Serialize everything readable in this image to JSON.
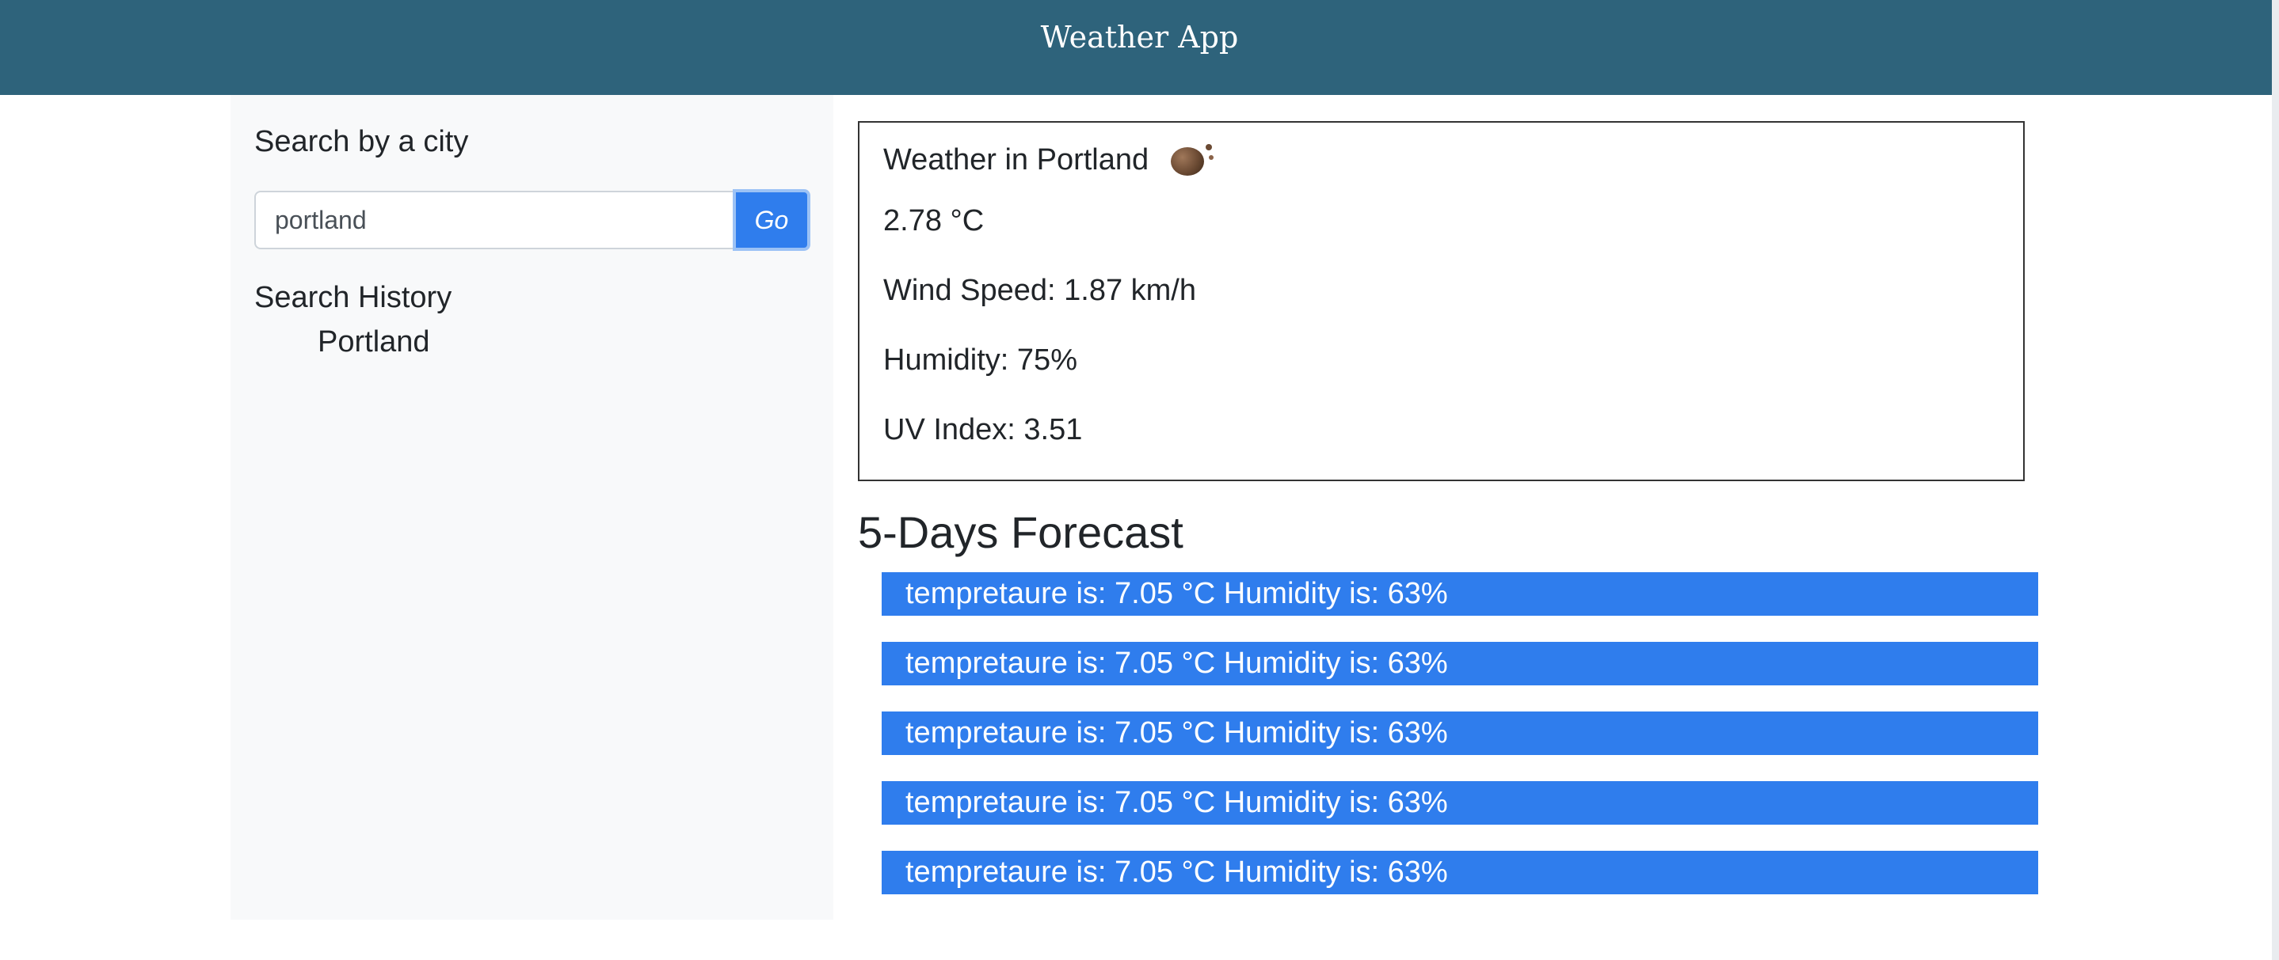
{
  "header": {
    "title": "Weather App"
  },
  "sidebar": {
    "search_heading": "Search by a city",
    "search_input_value": "portland",
    "go_label": "Go",
    "history_heading": "Search History",
    "history_items": [
      "Portland"
    ]
  },
  "current": {
    "title": "Weather in Portland",
    "icon": "weather-condition-icon",
    "temperature": "2.78 °C",
    "wind": "Wind Speed: 1.87 km/h",
    "humidity": "Humidity: 75%",
    "uv": "UV Index: 3.51"
  },
  "forecast": {
    "heading": "5-Days Forecast",
    "items": [
      "tempretaure is: 7.05 °C Humidity is: 63%",
      "tempretaure is: 7.05 °C Humidity is: 63%",
      "tempretaure is: 7.05 °C Humidity is: 63%",
      "tempretaure is: 7.05 °C Humidity is: 63%",
      "tempretaure is: 7.05 °C Humidity is: 63%"
    ]
  },
  "colors": {
    "header_bg": "#2e637b",
    "accent": "#2f7ded",
    "sidebar_bg": "#f8f9fa"
  }
}
